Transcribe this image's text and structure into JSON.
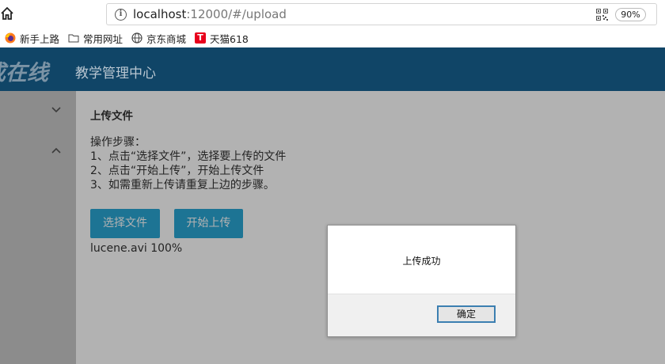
{
  "browser": {
    "url_host": "localhost",
    "url_rest": ":12000/#/upload",
    "zoom": "90%",
    "bookmarks": [
      {
        "label": "新手上路",
        "icon": "firefox-icon"
      },
      {
        "label": "常用网址",
        "icon": "folder-icon"
      },
      {
        "label": "京东商城",
        "icon": "globe-icon"
      },
      {
        "label": "天猫618",
        "icon": "tmall-icon"
      }
    ]
  },
  "header": {
    "logo_text": "成在线",
    "title": "教学管理中心"
  },
  "page": {
    "section_title": "上传文件",
    "steps_heading": "操作步骤：",
    "steps": [
      "1、点击“选择文件”，选择要上传的文件",
      "2、点击“开始上传”，开始上传文件",
      "3、如需重新上传请重复上边的步骤。"
    ],
    "select_button": "选择文件",
    "start_button": "开始上传",
    "file_status": "lucene.avi 100%"
  },
  "dialog": {
    "message": "上传成功",
    "ok_button": "确定"
  },
  "colors": {
    "header_bg": "#104567",
    "button_bg": "#2aa6d5",
    "dialog_border": "#3c7fb1"
  }
}
